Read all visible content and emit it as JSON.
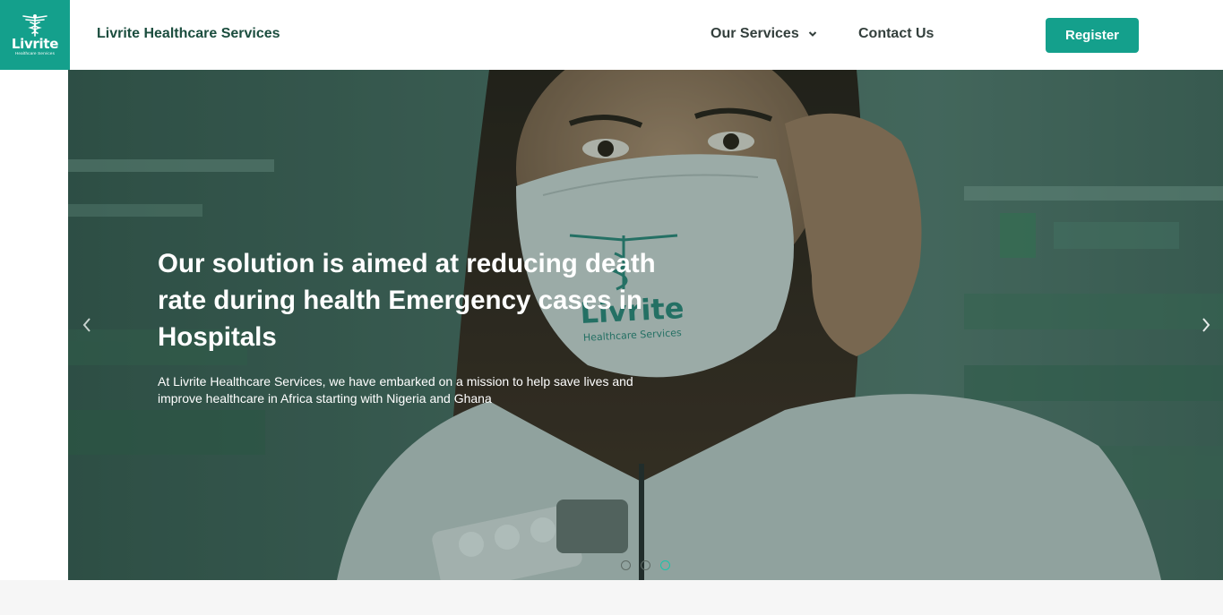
{
  "logo": {
    "word": "Livrite",
    "subtitle": "Healthcare Services"
  },
  "nav": {
    "brand": "Livrite Healthcare Services",
    "services_label": "Our Services",
    "contact_label": "Contact Us",
    "register_label": "Register"
  },
  "hero": {
    "title": "Our solution is aimed at reducing death rate during health Emergency cases in Hospitals",
    "description": "At Livrite Healthcare Services, we have embarked on a mission to help save lives and improve healthcare in Africa starting with Nigeria and Ghana",
    "mask_word": "Livrite",
    "mask_subtitle": "Healthcare Services",
    "slides": 3,
    "active_slide": 3
  },
  "colors": {
    "accent": "#14a08c",
    "brand_text": "#1b4d3e",
    "active_dot": "#19c4aa"
  },
  "icons": [
    "caduceus-logo-icon",
    "chevron-down-icon",
    "chevron-left-icon",
    "chevron-right-icon"
  ]
}
